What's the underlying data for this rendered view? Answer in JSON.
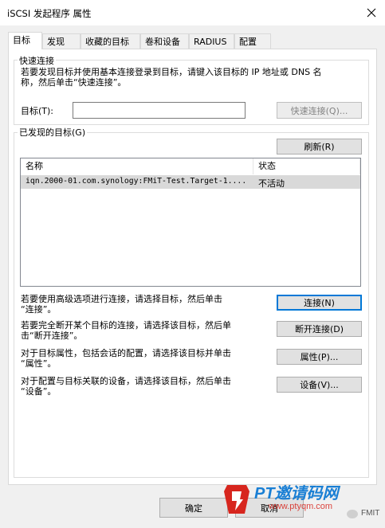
{
  "window": {
    "title": "iSCSI 发起程序 属性"
  },
  "tabs": [
    {
      "label": "目标",
      "active": true
    },
    {
      "label": "发现"
    },
    {
      "label": "收藏的目标"
    },
    {
      "label": "卷和设备"
    },
    {
      "label": "RADIUS"
    },
    {
      "label": "配置"
    }
  ],
  "quick_connect": {
    "legend": "快速连接",
    "desc_line1": "若要发现目标并使用基本连接登录到目标，请键入该目标的 IP 地址或 DNS 名",
    "desc_line2": "称，然后单击“快速连接”。",
    "target_label": "目标(T):",
    "target_value": "",
    "button": "快速连接(Q)..."
  },
  "discovered": {
    "legend": "已发现的目标(G)",
    "refresh_button": "刷新(R)",
    "columns": [
      "名称",
      "状态"
    ],
    "rows": [
      {
        "name": "iqn.2000-01.com.synology:FMiT-Test.Target-1....",
        "status": "不活动"
      }
    ]
  },
  "actions": [
    {
      "line1": "若要使用高级选项进行连接，请选择目标，然后单击",
      "line2": "“连接”。",
      "button": "连接(N)"
    },
    {
      "line1": "若要完全断开某个目标的连接，请选择该目标，然后单",
      "line2": "击“断开连接”。",
      "button": "断开连接(D)"
    },
    {
      "line1": "对于目标属性，包括会话的配置，请选择该目标并单击",
      "line2": "“属性”。",
      "button": "属性(P)..."
    },
    {
      "line1": "对于配置与目标关联的设备，请选择该目标，然后单击",
      "line2": "“设备”。",
      "button": "设备(V)..."
    }
  ],
  "footer": {
    "ok": "确定",
    "cancel": "取消"
  },
  "watermark": {
    "brand": "PT邀请码网",
    "url": "www.ptyqm.com",
    "badge": "FMIT"
  },
  "colors": {
    "accent": "#0078d7",
    "watermark_red": "#d7261e",
    "watermark_blue": "#1a7fd4"
  }
}
